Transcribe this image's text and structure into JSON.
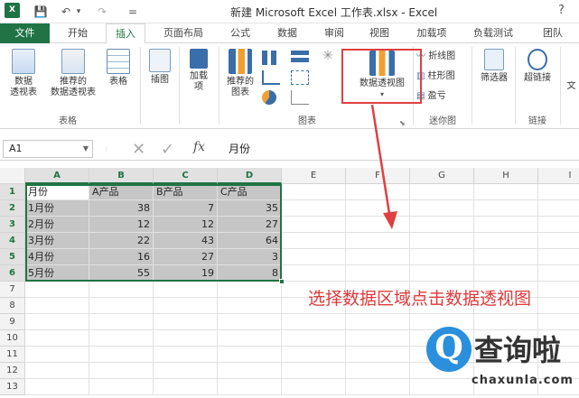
{
  "window": {
    "title": "新建 Microsoft Excel 工作表.xlsx - Excel",
    "help": "?"
  },
  "logo": {
    "icon": "excel-logo",
    "text": "X"
  },
  "qat": {
    "save": "💾",
    "undo": "↶",
    "undo_dd": "▾",
    "redo": "↷",
    "customize": "="
  },
  "tabs": [
    "文件",
    "开始",
    "插入",
    "页面布局",
    "公式",
    "数据",
    "审阅",
    "视图",
    "加载项",
    "负载测试",
    "团队"
  ],
  "active_tab": "插入",
  "ribbon": {
    "pivot_table": "数据\n透视表",
    "recommended_pivot": "推荐的\n数据透视表",
    "table": "表格",
    "group_tables": "表格",
    "illustrations": "插图",
    "addins": "加载\n项",
    "recommended_charts": "推荐的\n图表",
    "pivot_chart": "数据透视图",
    "pivot_chart_dd": "▾",
    "group_charts": "图表",
    "sparkline_line": "折线图",
    "sparkline_column": "柱形图",
    "sparkline_winloss": "盈亏",
    "group_sparklines": "迷你图",
    "slicer": "筛选器",
    "hyperlink": "超链接",
    "group_links": "链接",
    "text_partial": "文"
  },
  "formula_bar": {
    "name_box": "A1",
    "cancel": "✕",
    "enter": "✓",
    "fx": "fx",
    "content": "月份"
  },
  "sheet": {
    "columns": [
      "A",
      "B",
      "C",
      "D",
      "E",
      "F",
      "G",
      "H",
      "I"
    ],
    "rows": [
      "1",
      "2",
      "3",
      "4",
      "5",
      "6",
      "7",
      "8",
      "9",
      "10",
      "11",
      "12",
      "13"
    ],
    "header": [
      "月份",
      "A产品",
      "B产品",
      "C产品"
    ],
    "data": [
      [
        "1月份",
        "38",
        "7",
        "35"
      ],
      [
        "2月份",
        "12",
        "12",
        "27"
      ],
      [
        "3月份",
        "22",
        "43",
        "64"
      ],
      [
        "4月份",
        "16",
        "27",
        "3"
      ],
      [
        "5月份",
        "55",
        "19",
        "8"
      ]
    ]
  },
  "annotation": "选择数据区域点击数据透视图",
  "watermark": {
    "symbol": "Q",
    "cn": "查询啦",
    "en": "chaxunla.com"
  },
  "colors": {
    "excel_green": "#217346",
    "annotation_red": "#e03a3a",
    "highlight": "#c6c6c6"
  }
}
